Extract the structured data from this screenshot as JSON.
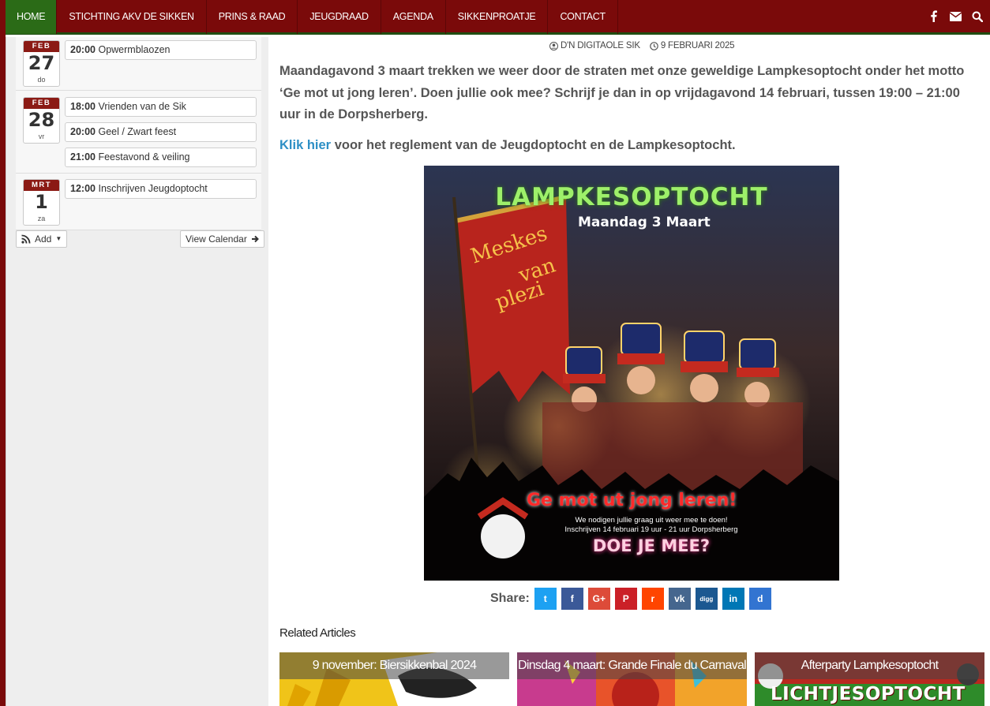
{
  "nav": {
    "items": [
      {
        "label": "HOME",
        "active": true
      },
      {
        "label": "STICHTING AKV DE SIKKEN"
      },
      {
        "label": "PRINS & RAAD"
      },
      {
        "label": "JEUGDRAAD"
      },
      {
        "label": "AGENDA"
      },
      {
        "label": "SIKKENPROATJE"
      },
      {
        "label": "CONTACT"
      }
    ],
    "icons": [
      "facebook-icon",
      "envelope-icon",
      "search-icon"
    ]
  },
  "calendar": {
    "days": [
      {
        "month": "FEB",
        "day": "27",
        "dow": "do",
        "events": [
          {
            "time": "20:00",
            "title": "Opwermblaozen"
          }
        ]
      },
      {
        "month": "FEB",
        "day": "28",
        "dow": "vr",
        "events": [
          {
            "time": "18:00",
            "title": "Vrienden van de Sik"
          },
          {
            "time": "20:00",
            "title": "Geel / Zwart feest"
          },
          {
            "time": "21:00",
            "title": "Feestavond & veiling"
          }
        ]
      },
      {
        "month": "MRT",
        "day": "1",
        "dow": "za",
        "events": [
          {
            "time": "12:00",
            "title": "Inschrijven Jeugdoptocht"
          }
        ]
      }
    ],
    "add_label": "Add",
    "view_label": "View Calendar"
  },
  "article": {
    "author": "D'N DIGITAOLE SIK",
    "date": "9 FEBRUARI 2025",
    "paragraph": "Maandagavond 3 maart trekken we weer door de straten met onze geweldige Lampkesoptocht onder het motto ‘Ge mot ut jong leren’. Doen jullie ook mee? Schrijf je dan in op vrijdagavond 14 februari, tussen 19:00 – 21:00 uur in de Dorpsherberg.",
    "link_text": "Klik hier",
    "link_rest": " voor het reglement van de Jeugdoptocht en de Lampkesoptocht."
  },
  "poster": {
    "title": "LAMPKESOPTOCHT",
    "subtitle": "Maandag 3 Maart",
    "banner_text": [
      "Meskes",
      "van",
      "plezi"
    ],
    "slogan": "Ge mot ut jong leren!",
    "line1": "We nodigen jullie graag uit weer mee te doen!",
    "line2": "Inschrijven 14 februari 19 uur - 21 uur Dorpsherberg",
    "cta": "DOE JE MEE?"
  },
  "share": {
    "label": "Share:",
    "buttons": [
      {
        "name": "twitter",
        "color": "#1da1f2",
        "glyph": "t"
      },
      {
        "name": "facebook",
        "color": "#3b5998",
        "glyph": "f"
      },
      {
        "name": "google-plus",
        "color": "#dd4b39",
        "glyph": "G+"
      },
      {
        "name": "pinterest",
        "color": "#cb2027",
        "glyph": "P"
      },
      {
        "name": "reddit",
        "color": "#ff4500",
        "glyph": "r"
      },
      {
        "name": "vk",
        "color": "#45668e",
        "glyph": "vk"
      },
      {
        "name": "digg",
        "color": "#1b5891",
        "glyph": "digg"
      },
      {
        "name": "linkedin",
        "color": "#0077b5",
        "glyph": "in"
      },
      {
        "name": "delicious",
        "color": "#3274d1",
        "glyph": "d"
      }
    ]
  },
  "related": {
    "title": "Related Articles",
    "items": [
      {
        "caption": "9 november: Biersikkenbal 2024"
      },
      {
        "caption": "Dinsdag 4 maart: Grande Finale du Carnaval"
      },
      {
        "caption": "Afterparty Lampkesoptocht"
      }
    ],
    "third_image_text": "LICHTJESOPTOCHT"
  },
  "colors": {
    "nav_bg": "#7a0a0a",
    "nav_active": "#2b6b17",
    "link": "#2d8fc5"
  }
}
